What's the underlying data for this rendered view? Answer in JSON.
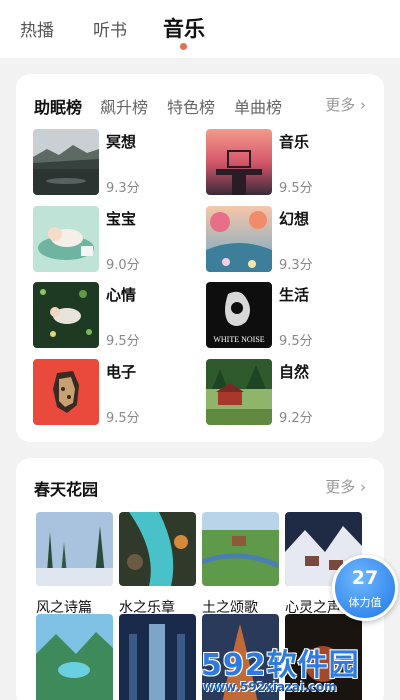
{
  "top_tabs": [
    {
      "label": "热播"
    },
    {
      "label": "听书"
    },
    {
      "label": "音乐"
    }
  ],
  "ranking": {
    "tabs": [
      "助眠榜",
      "飙升榜",
      "特色榜",
      "单曲榜"
    ],
    "more": "更多",
    "items": [
      {
        "name": "冥想",
        "score": "9.3分"
      },
      {
        "name": "音乐",
        "score": "9.5分"
      },
      {
        "name": "宝宝",
        "score": "9.0分"
      },
      {
        "name": "幻想",
        "score": "9.3分"
      },
      {
        "name": "心情",
        "score": "9.5分"
      },
      {
        "name": "生活",
        "score": "9.5分",
        "thumb_text": "WHITE NOISE"
      },
      {
        "name": "电子",
        "score": "9.5分"
      },
      {
        "name": "自然",
        "score": "9.2分"
      }
    ]
  },
  "spring": {
    "title": "春天花园",
    "more": "更多",
    "tiles": [
      "风之诗篇",
      "水之乐章",
      "土之颂歌",
      "心灵之声"
    ]
  },
  "stamina": {
    "value": "27",
    "label": "体力值"
  },
  "watermark": {
    "brand": "592软件园",
    "url": "www.592xiazai.com"
  }
}
